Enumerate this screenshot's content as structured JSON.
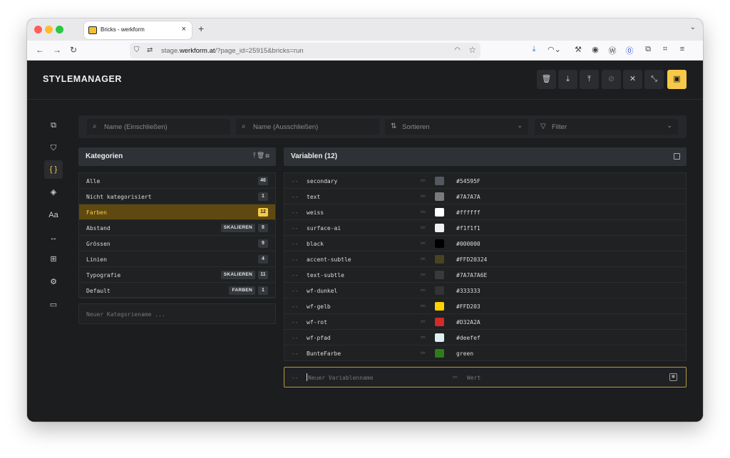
{
  "browser": {
    "tab_title": "Bricks - werkform",
    "tab_close": "×",
    "new_tab": "+",
    "url_prefix": "stage.",
    "url_domain": "werkform.at",
    "url_path": "/?page_id=25915&bricks=run"
  },
  "app": {
    "title": "STYLEMANAGER",
    "header_buttons": [
      {
        "name": "delete",
        "icon": "🗑"
      },
      {
        "name": "download",
        "icon": "⤓"
      },
      {
        "name": "upload",
        "icon": "⤒"
      },
      {
        "name": "hide",
        "icon": "⊘"
      },
      {
        "name": "close",
        "icon": "✕"
      },
      {
        "name": "minimize",
        "icon": "⤡"
      },
      {
        "name": "save",
        "icon": "▣"
      }
    ],
    "sidebar_icons": [
      "classes-icon",
      "css-icon",
      "variables-icon",
      "color-icon",
      "typography-icon",
      "spacing-icon",
      "grid-icon",
      "settings-icon",
      "folder-icon"
    ]
  },
  "toolbar": {
    "include_placeholder": "Name (Einschließen)",
    "exclude_placeholder": "Name (Ausschließen)",
    "sort_label": "Sortieren",
    "filter_label": "Filter"
  },
  "categories": {
    "title": "Kategorien",
    "items": [
      {
        "name": "Alle",
        "count": "46",
        "badge": ""
      },
      {
        "name": "Nicht kategorisiert",
        "count": "1",
        "badge": ""
      },
      {
        "name": "Farben",
        "count": "12",
        "badge": "",
        "active": true
      },
      {
        "name": "Abstand",
        "count": "8",
        "badge": "SKALIEREN"
      },
      {
        "name": "Grössen",
        "count": "9",
        "badge": ""
      },
      {
        "name": "Linien",
        "count": "4",
        "badge": ""
      },
      {
        "name": "Typografie",
        "count": "11",
        "badge": "SKALIEREN"
      },
      {
        "name": "Default",
        "count": "1",
        "badge": "FARBEN"
      }
    ],
    "new_placeholder": "Neuer Kategoriename ..."
  },
  "variables": {
    "title": "Variablen (12)",
    "prefix": "--",
    "items": [
      {
        "name": "secondary",
        "value": "#54595F",
        "swatch": "#54595F"
      },
      {
        "name": "text",
        "value": "#7A7A7A",
        "swatch": "#7A7A7A"
      },
      {
        "name": "weiss",
        "value": "#ffffff",
        "swatch": "#ffffff"
      },
      {
        "name": "surface-ai",
        "value": "#f1f1f1",
        "swatch": "#f1f1f1"
      },
      {
        "name": "black",
        "value": "#000000",
        "swatch": "#000000"
      },
      {
        "name": "accent-subtle",
        "value": "#FFD20324",
        "swatch": "#4a4220"
      },
      {
        "name": "text-subtle",
        "value": "#7A7A7A6E",
        "swatch": "#3a3a3a"
      },
      {
        "name": "wf-dunkel",
        "value": "#333333",
        "swatch": "#333333"
      },
      {
        "name": "wf-gelb",
        "value": "#FFD203",
        "swatch": "#FFD203"
      },
      {
        "name": "wf-rot",
        "value": "#D32A2A",
        "swatch": "#D32A2A"
      },
      {
        "name": "wf-pfad",
        "value": "#deefef",
        "swatch": "#deefef"
      },
      {
        "name": "BunteFarbe",
        "value": "green",
        "swatch": "#2e7d1a"
      }
    ],
    "new_name_placeholder": "Neuer Variablenname",
    "new_value_placeholder": "Wert"
  },
  "colors": {
    "accent": "#f7c948",
    "background": "#1c1d1f",
    "panel": "#2e3136"
  }
}
